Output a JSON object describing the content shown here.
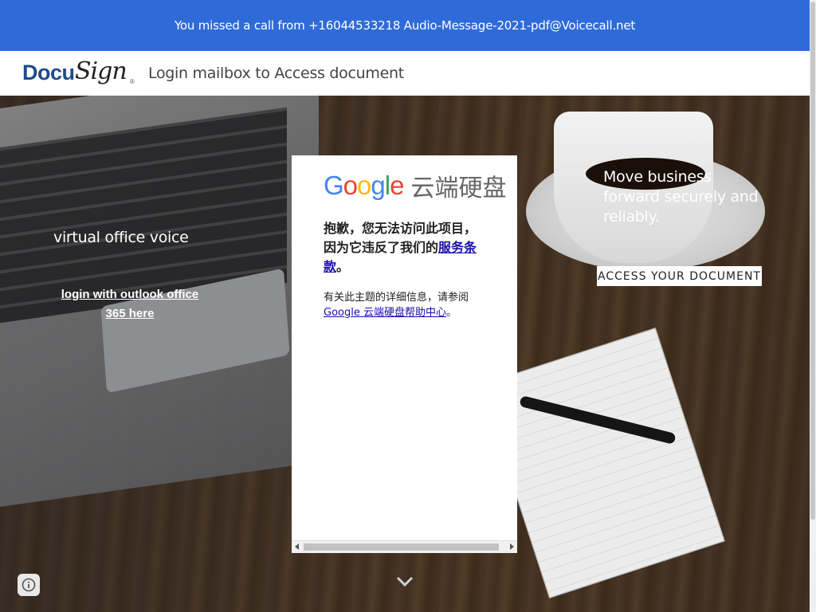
{
  "banner": {
    "text": "You missed a call from +16044533218 Audio-Message-2021-pdf@Voicecall.net"
  },
  "header": {
    "logo": {
      "part1": "Docu",
      "part2": "Sign",
      "reg": "®"
    },
    "title": "Login mailbox to Access document"
  },
  "hero": {
    "left": {
      "title": "virtual office voice",
      "link_line1": "login with outlook office",
      "link_line2": "365 here"
    },
    "right": {
      "title": "Move business forward securely and reliably.",
      "button": "ACCESS YOUR DOCUMENT"
    }
  },
  "panel": {
    "logo_letters": [
      "G",
      "o",
      "o",
      "g",
      "l",
      "e"
    ],
    "logo_colors": [
      "#4285F4",
      "#EA4335",
      "#FBBC05",
      "#4285F4",
      "#34A853",
      "#EA4335"
    ],
    "logo_suffix": "云端硬盘",
    "error_text": "抱歉，您无法访问此项目，因为它违反了我们的",
    "error_link": "服务条款",
    "error_end": "。",
    "info_text": "有关此主题的详细信息，请参阅",
    "info_link": "Google 云端硬盘帮助中心",
    "info_end": "。"
  },
  "icons": {
    "chevron": "chevron-down-icon",
    "info": "info-icon"
  }
}
